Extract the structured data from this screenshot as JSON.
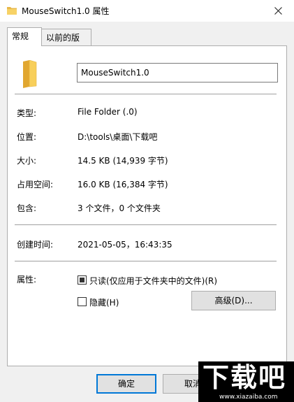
{
  "window": {
    "title": "MouseSwitch1.0 属性"
  },
  "tabs": [
    {
      "label": "常规"
    },
    {
      "label": "以前的版本"
    }
  ],
  "general": {
    "name_value": "MouseSwitch1.0",
    "rows": [
      {
        "label": "类型:",
        "value": "File Folder (.0)"
      },
      {
        "label": "位置:",
        "value": "D:\\tools\\桌面\\下载吧"
      },
      {
        "label": "大小:",
        "value": "14.5 KB (14,939 字节)"
      },
      {
        "label": "占用空间:",
        "value": "16.0 KB (16,384 字节)"
      },
      {
        "label": "包含:",
        "value": "3 个文件，0 个文件夹"
      }
    ],
    "created": {
      "label": "创建时间:",
      "value": "2021-05-05，16:43:35"
    },
    "attributes": {
      "label": "属性:",
      "readonly": {
        "label": "只读(仅应用于文件夹中的文件)(R)",
        "checked": "indeterminate"
      },
      "hidden": {
        "label": "隐藏(H)",
        "checked": false
      },
      "advanced_label": "高级(D)..."
    }
  },
  "buttons": {
    "ok": "确定",
    "cancel": "取消"
  },
  "watermark": {
    "text": "下载吧",
    "url": "www.xiazaiba.com"
  }
}
